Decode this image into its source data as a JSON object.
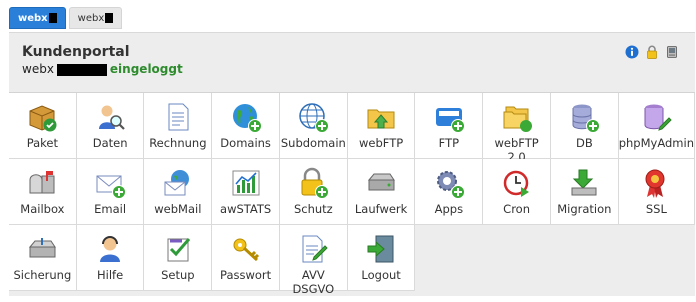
{
  "tabs": [
    {
      "label": "webx",
      "active": true
    },
    {
      "label": "webx",
      "active": false
    }
  ],
  "header": {
    "title": "Kundenportal",
    "user_prefix": "webx",
    "status": "eingeloggt"
  },
  "header_icons": [
    "info-icon",
    "lock-icon",
    "database-icon"
  ],
  "tiles": [
    {
      "label": "Paket",
      "icon": "package-icon"
    },
    {
      "label": "Daten",
      "icon": "user-search-icon"
    },
    {
      "label": "Rechnung",
      "icon": "invoice-icon"
    },
    {
      "label": "Domains",
      "icon": "globe-add-icon"
    },
    {
      "label": "Subdomain",
      "icon": "subdomain-globe-icon"
    },
    {
      "label": "webFTP",
      "icon": "folder-upload-icon"
    },
    {
      "label": "FTP",
      "icon": "ftp-icon"
    },
    {
      "label": "webFTP\n2.0",
      "icon": "folder-stack-icon"
    },
    {
      "label": "DB",
      "icon": "database-add-icon"
    },
    {
      "label": "phpMyAdmin",
      "icon": "database-edit-icon"
    },
    {
      "label": "Mailbox",
      "icon": "mailbox-icon"
    },
    {
      "label": "Email",
      "icon": "email-add-icon"
    },
    {
      "label": "webMail",
      "icon": "webmail-icon"
    },
    {
      "label": "awSTATS",
      "icon": "stats-chart-icon"
    },
    {
      "label": "Schutz",
      "icon": "lock-add-icon"
    },
    {
      "label": "Laufwerk",
      "icon": "drive-icon"
    },
    {
      "label": "Apps",
      "icon": "gear-add-icon"
    },
    {
      "label": "Cron",
      "icon": "clock-play-icon"
    },
    {
      "label": "Migration",
      "icon": "download-migration-icon"
    },
    {
      "label": "SSL",
      "icon": "ribbon-badge-icon"
    },
    {
      "label": "Sicherung",
      "icon": "backup-drive-icon"
    },
    {
      "label": "Hilfe",
      "icon": "support-headset-icon"
    },
    {
      "label": "Setup",
      "icon": "setup-check-icon"
    },
    {
      "label": "Passwort",
      "icon": "key-icon"
    },
    {
      "label": "AVV\nDSGVO",
      "icon": "document-edit-icon"
    },
    {
      "label": "Logout",
      "icon": "logout-door-icon"
    }
  ]
}
